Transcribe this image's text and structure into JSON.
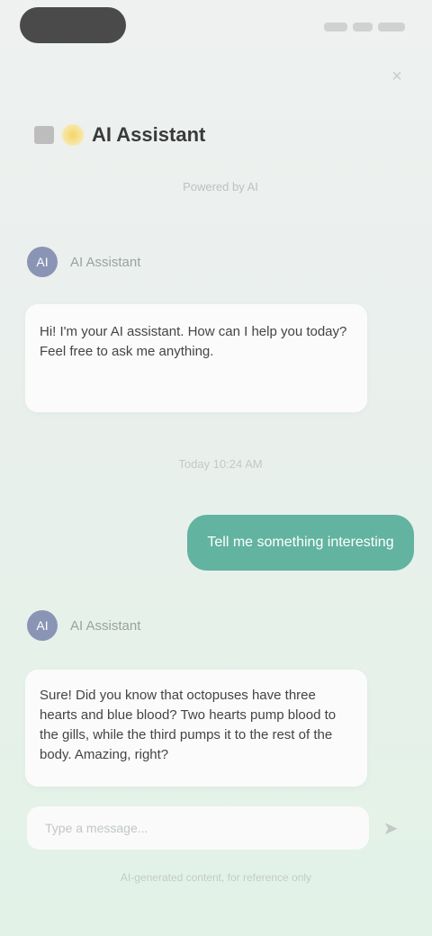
{
  "status_bar": {
    "pill": "",
    "right": ""
  },
  "header": {
    "close_icon": "×",
    "title": "AI Assistant",
    "subtitle": "Powered by AI"
  },
  "conversation": {
    "bot_name": "AI Assistant",
    "bot_avatar_glyph": "AI",
    "first_message": "Hi! I'm your AI assistant. How can I help you today? Feel free to ask me anything.",
    "timestamp": "Today 10:24 AM",
    "user_message": "Tell me something interesting",
    "second_bot_name": "AI Assistant",
    "second_message": "Sure! Did you know that octopuses have three hearts and blue blood? Two hearts pump blood to the gills, while the third pumps it to the rest of the body. Amazing, right?"
  },
  "composer": {
    "placeholder": "Type a message...",
    "send_icon": "➤"
  },
  "footer": {
    "disclaimer": "AI-generated content, for reference only"
  },
  "colors": {
    "accent": "#62b3a0",
    "avatar": "#8a95b5",
    "title_emoji": "#f3d66a"
  }
}
